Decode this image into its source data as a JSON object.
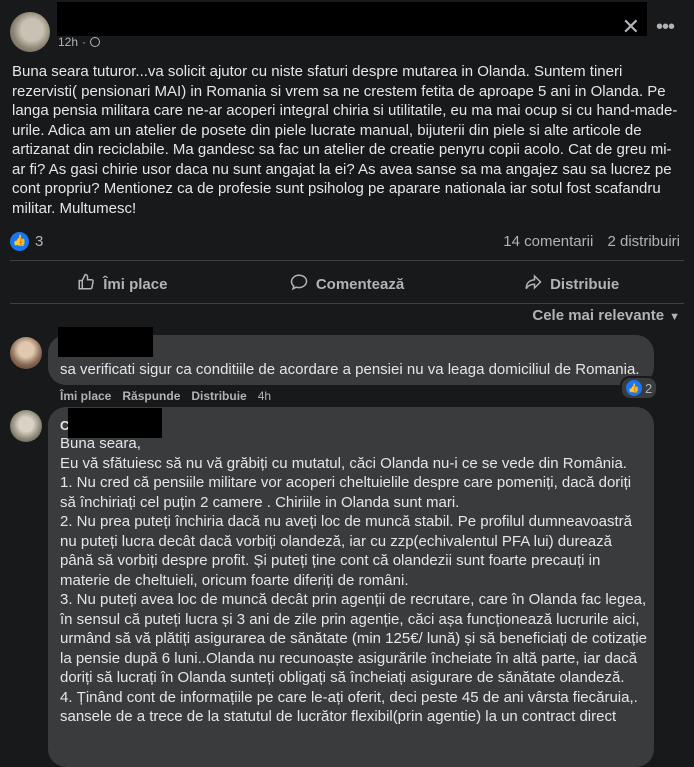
{
  "post": {
    "time": "12h",
    "text": "Buna seara tuturor...va solicit ajutor cu niste sfaturi despre mutarea in Olanda. Suntem tineri rezervisti( pensionari MAI) in Romania si vrem sa ne crestem fetita de aproape 5 ani in Olanda. Pe langa pensia militara care ne-ar acoperi integral chiria si utilitatile, eu ma mai ocup si cu hand-made-urile. Adica am un atelier de posete din piele lucrate manual, bijuterii din piele si alte articole de artizanat din reciclabile. Ma gandesc sa fac un atelier de creatie penyru copii acolo. Cat de greu mi-ar fi? As gasi chirie usor daca nu sunt angajat la ei? As avea sanse sa ma angajez sau sa lucrez pe cont propriu? Mentionez ca de profesie sunt psiholog pe aparare nationala iar sotul fost scafandru militar. Multumesc!",
    "reaction_count": "3",
    "comments_count": "14 comentarii",
    "shares_count": "2 distribuiri"
  },
  "actions": {
    "like": "Îmi place",
    "comment": "Comentează",
    "share": "Distribuie"
  },
  "sort": {
    "label": "Cele mai relevante"
  },
  "comments": [
    {
      "text": "sa verificati sigur ca conditiile de acordare a pensiei nu va leaga domiciliul de Romania.",
      "reaction_count": "2",
      "like": "Îmi place",
      "reply": "Răspunde",
      "share": "Distribuie",
      "time": "4h"
    },
    {
      "name_fragment": "C",
      "lines": [
        "Buna seara,",
        "Eu vă sfătuiesc să nu vă grăbiți cu mutatul, căci Olanda nu-i ce se vede din România.",
        "1. Nu cred că pensiile militare vor acoperi cheltuielile despre care pomeniți, dacă doriți să închiriați cel puțin 2 camere . Chiriile in Olanda sunt mari.",
        "2. Nu prea puteți închiria dacă nu aveți loc de muncă stabil. Pe profilul dumneavoastră nu puteți lucra decât dacă vorbiți olandeză, iar cu zzp(echivalentul PFA lui) durează până să vorbiți despre profit. Și puteți ține cont că olandezii sunt foarte precauți in materie de cheltuieli, oricum foarte diferiți de români.",
        "3. Nu puteți avea loc de muncă decât prin agenții de recrutare, care în Olanda fac legea, în sensul că puteți lucra și 3 ani de zile prin agenție, căci așa funcționează lucrurile aici, urmând să vă plătiți asigurarea de sănătate (min 125€/ lună) și să beneficiați de cotizație la pensie după 6 luni..Olanda nu recunoaște asigurările încheiate în altă parte, iar dacă doriți să lucrați în Olanda sunteți obligați să încheiați asigurare de sănătate olandeză.",
        "4. Ținând cont de informațiile pe care le-ați oferit, deci peste 45 de ani vârsta fiecăruia,. sansele de a trece de la statutul de lucrător flexibil(prin agentie) la un contract direct"
      ]
    }
  ],
  "icons": {
    "like": "thumbs-up-icon",
    "comment": "speech-bubble-icon",
    "share": "share-arrow-icon",
    "privacy": "globe-icon",
    "more": "more-horizontal-icon",
    "close": "close-icon",
    "sort": "chevron-down-icon"
  },
  "colors": {
    "background": "#18191a",
    "bubble": "#3a3b3c",
    "text": "#e4e6eb",
    "secondary_text": "#b0b3b8",
    "like_blue": "#1877f2"
  }
}
